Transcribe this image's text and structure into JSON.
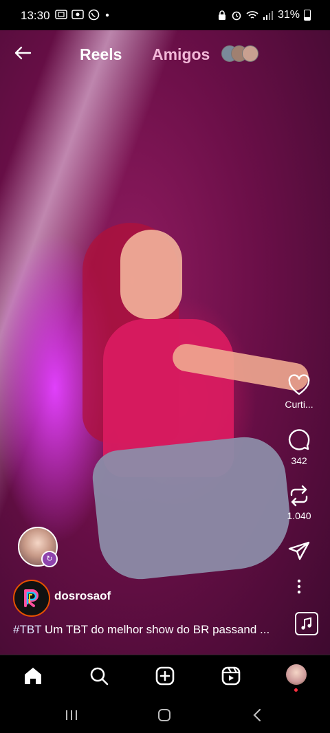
{
  "status_bar": {
    "time": "13:30",
    "battery": "31%",
    "icons_left": [
      "screenshot-icon",
      "screen-record-icon",
      "whatsapp-icon",
      "dot-icon"
    ],
    "icons_right": [
      "lock-icon",
      "alarm-icon",
      "wifi-icon",
      "signal-icon",
      "battery-icon"
    ]
  },
  "header": {
    "tab_reels": "Reels",
    "tab_friends": "Amigos"
  },
  "actions": {
    "like_label": "Curti...",
    "comments_count": "342",
    "reposts_count": "1.040"
  },
  "post": {
    "author": "dosrosaof",
    "caption_hashtag": "#TBT",
    "caption_text": " Um TBT do melhor show do BR passand ..."
  },
  "bottom_nav": {
    "items": [
      "home-icon",
      "search-icon",
      "create-icon",
      "reels-icon",
      "profile-avatar"
    ]
  },
  "colors": {
    "accent_friends": "#f2b8d8",
    "notification_dot": "#ff3040"
  }
}
